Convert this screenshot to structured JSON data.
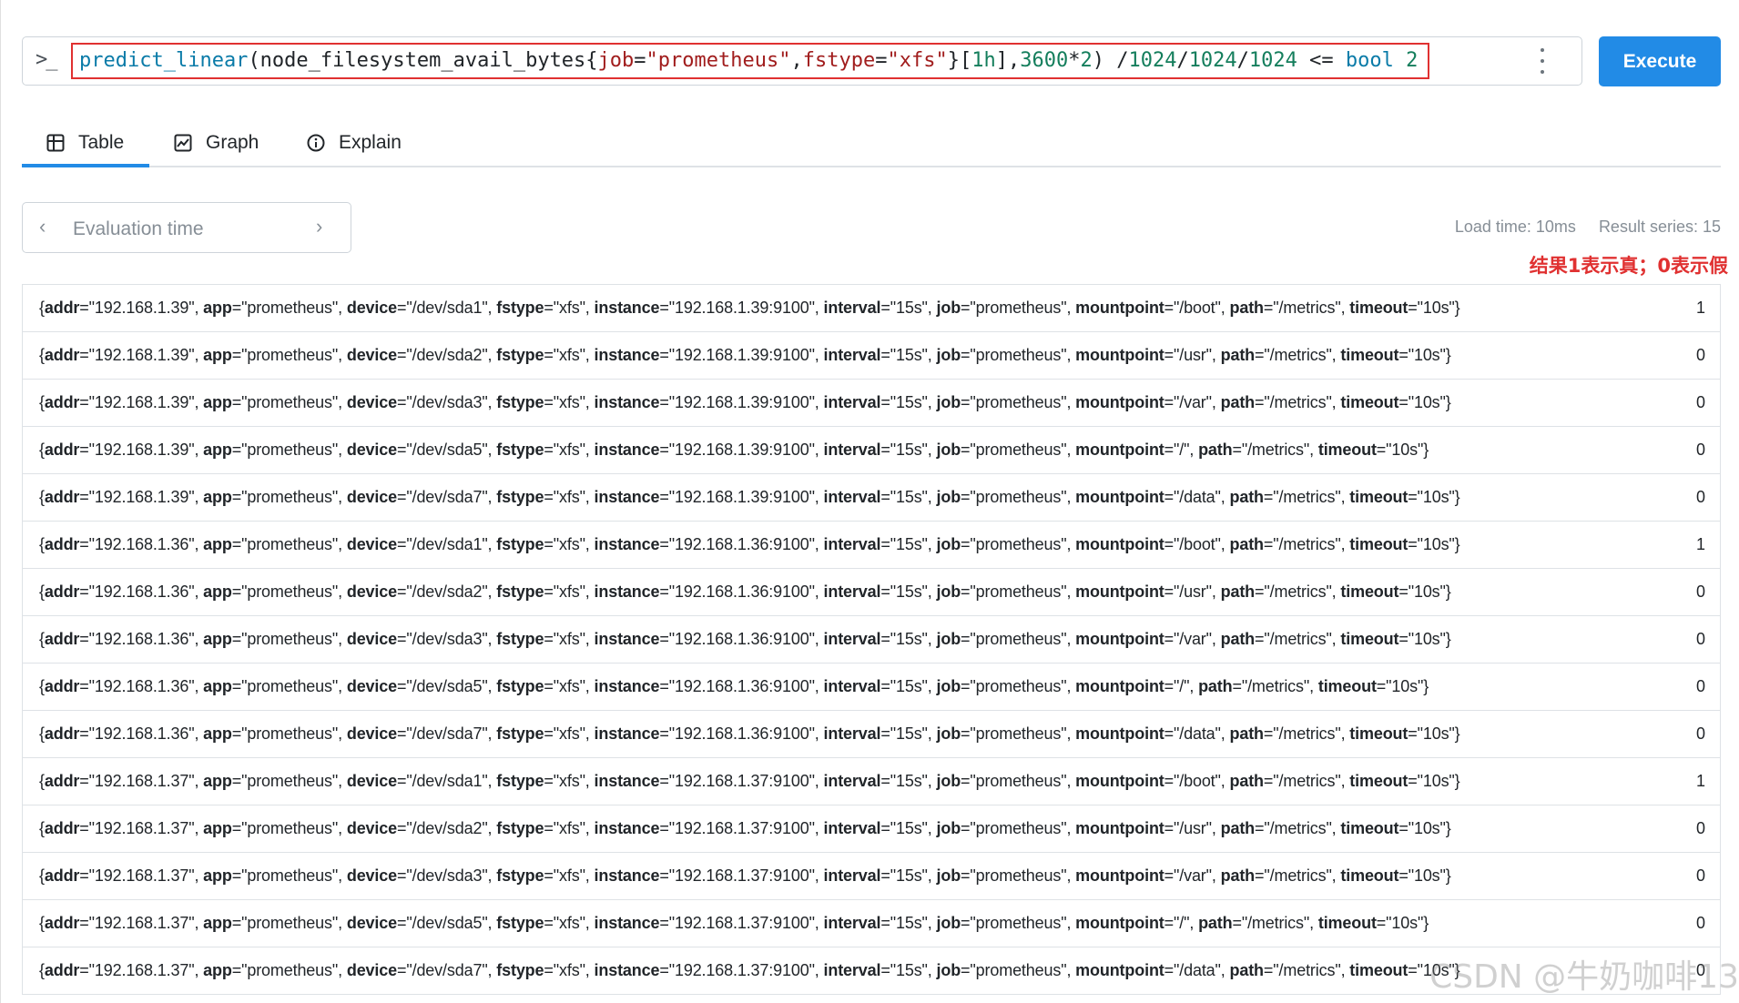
{
  "query": {
    "prompt_icon": ">_",
    "expression_parts": [
      {
        "text": "predict_linear",
        "kind": "fn"
      },
      {
        "text": "(node_filesystem_avail_bytes{",
        "kind": "op"
      },
      {
        "text": "job",
        "kind": "str"
      },
      {
        "text": "=",
        "kind": "op"
      },
      {
        "text": "\"prometheus\"",
        "kind": "str"
      },
      {
        "text": ",",
        "kind": "op"
      },
      {
        "text": "fstype",
        "kind": "str"
      },
      {
        "text": "=",
        "kind": "op"
      },
      {
        "text": "\"xfs\"",
        "kind": "str"
      },
      {
        "text": "}[",
        "kind": "op"
      },
      {
        "text": "1h",
        "kind": "num"
      },
      {
        "text": "],",
        "kind": "op"
      },
      {
        "text": "3600",
        "kind": "num"
      },
      {
        "text": "*",
        "kind": "op"
      },
      {
        "text": "2",
        "kind": "num"
      },
      {
        "text": ") ",
        "kind": "op"
      },
      {
        "text": "/",
        "kind": "op"
      },
      {
        "text": "1024",
        "kind": "num"
      },
      {
        "text": "/",
        "kind": "op"
      },
      {
        "text": "1024",
        "kind": "num"
      },
      {
        "text": "/",
        "kind": "op"
      },
      {
        "text": "1024",
        "kind": "num"
      },
      {
        "text": " <= ",
        "kind": "op"
      },
      {
        "text": "bool",
        "kind": "kw"
      },
      {
        "text": " ",
        "kind": "op"
      },
      {
        "text": "2",
        "kind": "num"
      }
    ],
    "execute_label": "Execute"
  },
  "tabs": [
    {
      "label": "Table",
      "icon": "table-icon",
      "active": true
    },
    {
      "label": "Graph",
      "icon": "graph-icon",
      "active": false
    },
    {
      "label": "Explain",
      "icon": "info-icon",
      "active": false
    }
  ],
  "evaluation": {
    "placeholder": "Evaluation time",
    "prev": "‹",
    "next": "›"
  },
  "stats": {
    "load_time": "Load time: 10ms",
    "result_series": "Result series: 15"
  },
  "annotation": "结果1表示真；0表示假",
  "colors": {
    "accent": "#228be6",
    "annotation_red": "#e03131",
    "function_blue": "#0a7ba8",
    "string_red": "#a11d1d",
    "number_green": "#147e5c"
  },
  "rows": [
    {
      "addr": "192.168.1.39",
      "app": "prometheus",
      "device": "/dev/sda1",
      "fstype": "xfs",
      "instance": "192.168.1.39:9100",
      "interval": "15s",
      "job": "prometheus",
      "mountpoint": "/boot",
      "path": "/metrics",
      "timeout": "10s",
      "value": "1"
    },
    {
      "addr": "192.168.1.39",
      "app": "prometheus",
      "device": "/dev/sda2",
      "fstype": "xfs",
      "instance": "192.168.1.39:9100",
      "interval": "15s",
      "job": "prometheus",
      "mountpoint": "/usr",
      "path": "/metrics",
      "timeout": "10s",
      "value": "0"
    },
    {
      "addr": "192.168.1.39",
      "app": "prometheus",
      "device": "/dev/sda3",
      "fstype": "xfs",
      "instance": "192.168.1.39:9100",
      "interval": "15s",
      "job": "prometheus",
      "mountpoint": "/var",
      "path": "/metrics",
      "timeout": "10s",
      "value": "0"
    },
    {
      "addr": "192.168.1.39",
      "app": "prometheus",
      "device": "/dev/sda5",
      "fstype": "xfs",
      "instance": "192.168.1.39:9100",
      "interval": "15s",
      "job": "prometheus",
      "mountpoint": "/",
      "path": "/metrics",
      "timeout": "10s",
      "value": "0"
    },
    {
      "addr": "192.168.1.39",
      "app": "prometheus",
      "device": "/dev/sda7",
      "fstype": "xfs",
      "instance": "192.168.1.39:9100",
      "interval": "15s",
      "job": "prometheus",
      "mountpoint": "/data",
      "path": "/metrics",
      "timeout": "10s",
      "value": "0"
    },
    {
      "addr": "192.168.1.36",
      "app": "prometheus",
      "device": "/dev/sda1",
      "fstype": "xfs",
      "instance": "192.168.1.36:9100",
      "interval": "15s",
      "job": "prometheus",
      "mountpoint": "/boot",
      "path": "/metrics",
      "timeout": "10s",
      "value": "1"
    },
    {
      "addr": "192.168.1.36",
      "app": "prometheus",
      "device": "/dev/sda2",
      "fstype": "xfs",
      "instance": "192.168.1.36:9100",
      "interval": "15s",
      "job": "prometheus",
      "mountpoint": "/usr",
      "path": "/metrics",
      "timeout": "10s",
      "value": "0"
    },
    {
      "addr": "192.168.1.36",
      "app": "prometheus",
      "device": "/dev/sda3",
      "fstype": "xfs",
      "instance": "192.168.1.36:9100",
      "interval": "15s",
      "job": "prometheus",
      "mountpoint": "/var",
      "path": "/metrics",
      "timeout": "10s",
      "value": "0"
    },
    {
      "addr": "192.168.1.36",
      "app": "prometheus",
      "device": "/dev/sda5",
      "fstype": "xfs",
      "instance": "192.168.1.36:9100",
      "interval": "15s",
      "job": "prometheus",
      "mountpoint": "/",
      "path": "/metrics",
      "timeout": "10s",
      "value": "0"
    },
    {
      "addr": "192.168.1.36",
      "app": "prometheus",
      "device": "/dev/sda7",
      "fstype": "xfs",
      "instance": "192.168.1.36:9100",
      "interval": "15s",
      "job": "prometheus",
      "mountpoint": "/data",
      "path": "/metrics",
      "timeout": "10s",
      "value": "0"
    },
    {
      "addr": "192.168.1.37",
      "app": "prometheus",
      "device": "/dev/sda1",
      "fstype": "xfs",
      "instance": "192.168.1.37:9100",
      "interval": "15s",
      "job": "prometheus",
      "mountpoint": "/boot",
      "path": "/metrics",
      "timeout": "10s",
      "value": "1"
    },
    {
      "addr": "192.168.1.37",
      "app": "prometheus",
      "device": "/dev/sda2",
      "fstype": "xfs",
      "instance": "192.168.1.37:9100",
      "interval": "15s",
      "job": "prometheus",
      "mountpoint": "/usr",
      "path": "/metrics",
      "timeout": "10s",
      "value": "0"
    },
    {
      "addr": "192.168.1.37",
      "app": "prometheus",
      "device": "/dev/sda3",
      "fstype": "xfs",
      "instance": "192.168.1.37:9100",
      "interval": "15s",
      "job": "prometheus",
      "mountpoint": "/var",
      "path": "/metrics",
      "timeout": "10s",
      "value": "0"
    },
    {
      "addr": "192.168.1.37",
      "app": "prometheus",
      "device": "/dev/sda5",
      "fstype": "xfs",
      "instance": "192.168.1.37:9100",
      "interval": "15s",
      "job": "prometheus",
      "mountpoint": "/",
      "path": "/metrics",
      "timeout": "10s",
      "value": "0"
    },
    {
      "addr": "192.168.1.37",
      "app": "prometheus",
      "device": "/dev/sda7",
      "fstype": "xfs",
      "instance": "192.168.1.37:9100",
      "interval": "15s",
      "job": "prometheus",
      "mountpoint": "/data",
      "path": "/metrics",
      "timeout": "10s",
      "value": "0"
    }
  ],
  "label_keys": [
    "addr",
    "app",
    "device",
    "fstype",
    "instance",
    "interval",
    "job",
    "mountpoint",
    "path",
    "timeout"
  ],
  "watermark": "CSDN @牛奶咖啡13"
}
